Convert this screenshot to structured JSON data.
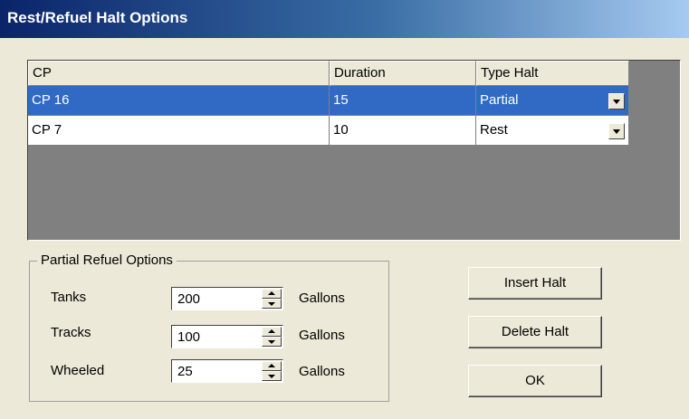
{
  "window": {
    "title": "Rest/Refuel Halt Options"
  },
  "grid": {
    "columns": [
      "CP",
      "Duration",
      "Type Halt"
    ],
    "rows": [
      {
        "cp": "CP 16",
        "duration": "15",
        "type": "Partial",
        "selected": true
      },
      {
        "cp": "CP 7",
        "duration": "10",
        "type": "Rest",
        "selected": false
      }
    ]
  },
  "partial_refuel": {
    "legend": "Partial Refuel Options",
    "items": [
      {
        "label": "Tanks",
        "value": "200",
        "unit": "Gallons"
      },
      {
        "label": "Tracks",
        "value": "100",
        "unit": "Gallons"
      },
      {
        "label": "Wheeled",
        "value": "25",
        "unit": "Gallons"
      }
    ]
  },
  "buttons": {
    "insert": "Insert Halt",
    "delete": "Delete Halt",
    "ok": "OK"
  },
  "colors": {
    "selection": "#316ac5",
    "dialog_bg": "#ece9d8",
    "grid_bg": "#808080",
    "title_start": "#0a246a",
    "title_end": "#a6caf0"
  }
}
